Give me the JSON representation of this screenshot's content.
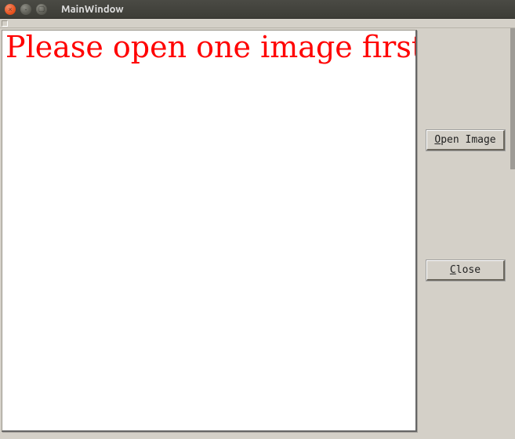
{
  "window": {
    "title": "MainWindow"
  },
  "canvas": {
    "message": "Please open one image first!"
  },
  "buttons": {
    "open_image": {
      "label_pre": "O",
      "label_post": "pen Image"
    },
    "close": {
      "label_pre": "C",
      "label_post": "lose"
    }
  }
}
